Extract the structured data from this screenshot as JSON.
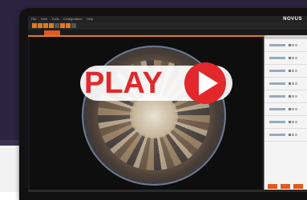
{
  "app": {
    "menu_items": [
      "File",
      "View",
      "Tools",
      "Configuration",
      "Help"
    ],
    "logo": "NOVUS"
  },
  "overlay": {
    "play_label": "PLAY"
  },
  "colors": {
    "accent": "#e07a1f",
    "play_red": "#e2282b",
    "background_top": "#2b2440",
    "background_bottom": "#f2f2f2"
  }
}
